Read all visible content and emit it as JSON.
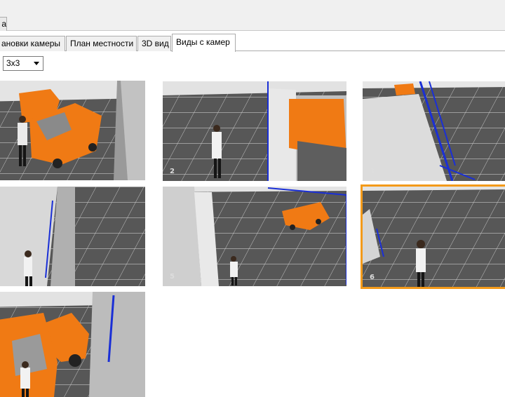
{
  "window": {
    "corner_button_label": "а"
  },
  "tabs": [
    {
      "label": "ановки камеры",
      "active": false
    },
    {
      "label": "План местности",
      "active": false
    },
    {
      "label": "3D вид",
      "active": false
    },
    {
      "label": "Виды с камер",
      "active": true
    }
  ],
  "layout_select": {
    "value": "3x3"
  },
  "cameras": [
    {
      "number": "",
      "selected": false
    },
    {
      "number": "2",
      "selected": false
    },
    {
      "number": "3",
      "selected": false
    },
    {
      "number": "",
      "selected": false
    },
    {
      "number": "5",
      "selected": false
    },
    {
      "number": "6",
      "selected": true
    },
    {
      "number": "",
      "selected": false
    }
  ],
  "colors": {
    "selection_border": "#f39a1a",
    "floor": "#575757",
    "car": "#f07a14",
    "zone_line": "#1a2fd6"
  }
}
